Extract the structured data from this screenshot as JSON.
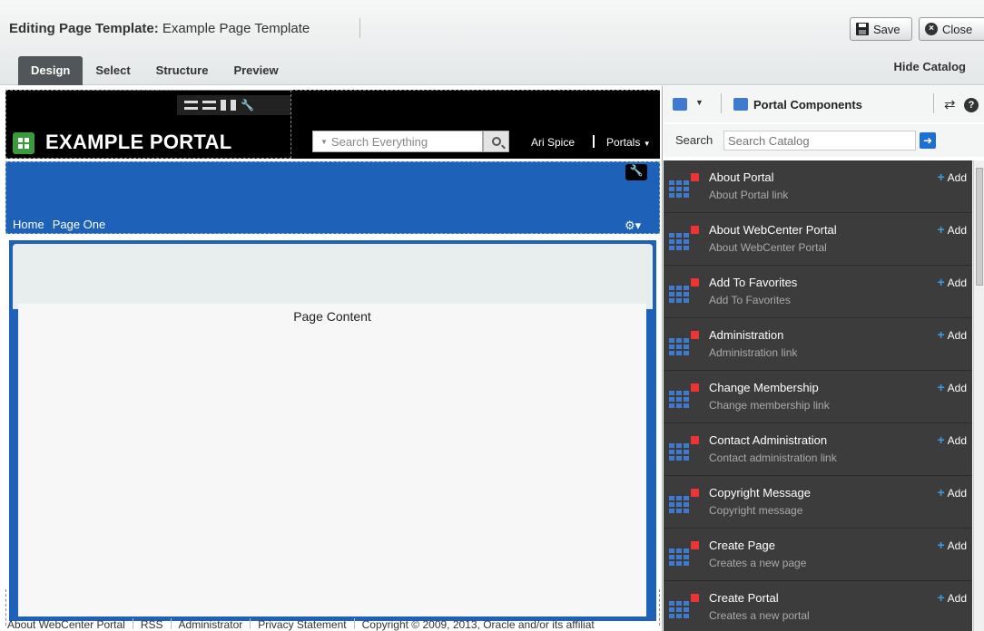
{
  "toolbar": {
    "title_prefix": "Editing Page Template:",
    "title_name": "Example Page Template",
    "save_label": "Save",
    "close_label": "Close"
  },
  "tabs": [
    {
      "label": "Design"
    },
    {
      "label": "Select"
    },
    {
      "label": "Structure"
    },
    {
      "label": "Preview"
    }
  ],
  "hide_catalog_label": "Hide Catalog",
  "portal": {
    "name": "EXAMPLE PORTAL",
    "search_placeholder": "Search Everything",
    "user": "Ari Spice",
    "portals_label": "Portals",
    "nav": [
      "Home",
      "Page One"
    ],
    "page_content": "Page Content",
    "footer": [
      "About WebCenter Portal",
      "RSS",
      "Administrator",
      "Privacy Statement",
      "Copyright © 2009, 2013, Oracle and/or its affiliat"
    ]
  },
  "catalog": {
    "title": "Portal Components",
    "search_label": "Search",
    "search_placeholder": "Search Catalog",
    "add_label": "Add",
    "items": [
      {
        "name": "About Portal",
        "desc": "About Portal link"
      },
      {
        "name": "About WebCenter Portal",
        "desc": "About WebCenter Portal"
      },
      {
        "name": "Add To Favorites",
        "desc": "Add To Favorites"
      },
      {
        "name": "Administration",
        "desc": "Administration link"
      },
      {
        "name": "Change Membership",
        "desc": "Change membership link"
      },
      {
        "name": "Contact Administration",
        "desc": "Contact administration link"
      },
      {
        "name": "Copyright Message",
        "desc": "Copyright message"
      },
      {
        "name": "Create Page",
        "desc": "Creates a new page"
      },
      {
        "name": "Create Portal",
        "desc": "Creates a new portal"
      }
    ]
  },
  "colors": {
    "accent": "#1d62b8",
    "catalog_bg": "#3c3c3c",
    "logo_green": "#3a9a3c"
  }
}
